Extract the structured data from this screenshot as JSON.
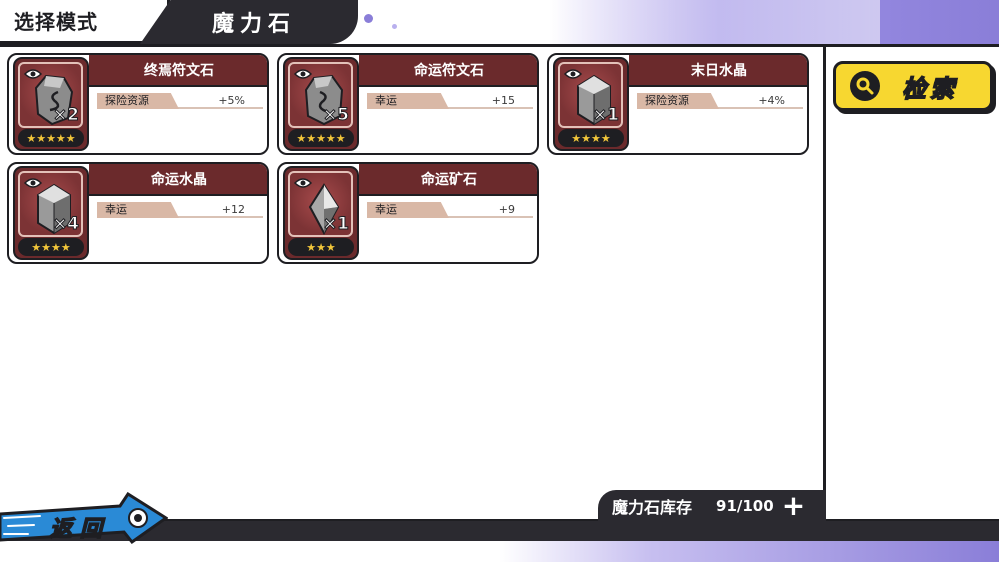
{
  "header": {
    "mode_tab": "选择模式",
    "title": "魔力石"
  },
  "search": {
    "label": "检索",
    "icon": "search-icon"
  },
  "items": [
    {
      "name": "终焉符文石",
      "count": "×2",
      "stars": "★★★★★",
      "star_count": 5,
      "stat_label": "探险资源",
      "stat_value": "+5%",
      "gem": "rune-stone"
    },
    {
      "name": "命运符文石",
      "count": "×5",
      "stars": "★★★★★",
      "star_count": 5,
      "stat_label": "幸运",
      "stat_value": "+15",
      "gem": "rune-stone"
    },
    {
      "name": "末日水晶",
      "count": "×1",
      "stars": "★★★★",
      "star_count": 4,
      "stat_label": "探险资源",
      "stat_value": "+4%",
      "gem": "crystal"
    },
    {
      "name": "命运水晶",
      "count": "×4",
      "stars": "★★★★",
      "star_count": 4,
      "stat_label": "幸运",
      "stat_value": "+12",
      "gem": "crystal"
    },
    {
      "name": "命运矿石",
      "count": "×1",
      "stars": "★★★",
      "star_count": 3,
      "stat_label": "幸运",
      "stat_value": "+9",
      "gem": "ore"
    }
  ],
  "inventory": {
    "label": "魔力石库存",
    "value": "91/100",
    "current": 91,
    "max": 100,
    "plus": "+"
  },
  "back": {
    "label": "返回"
  },
  "colors": {
    "accent_dark": "#2b2a30",
    "card_header": "#6b2a2c",
    "search_yellow": "#f7d730",
    "background_purple": "#8a7ed8",
    "star": "#f2c63a"
  }
}
